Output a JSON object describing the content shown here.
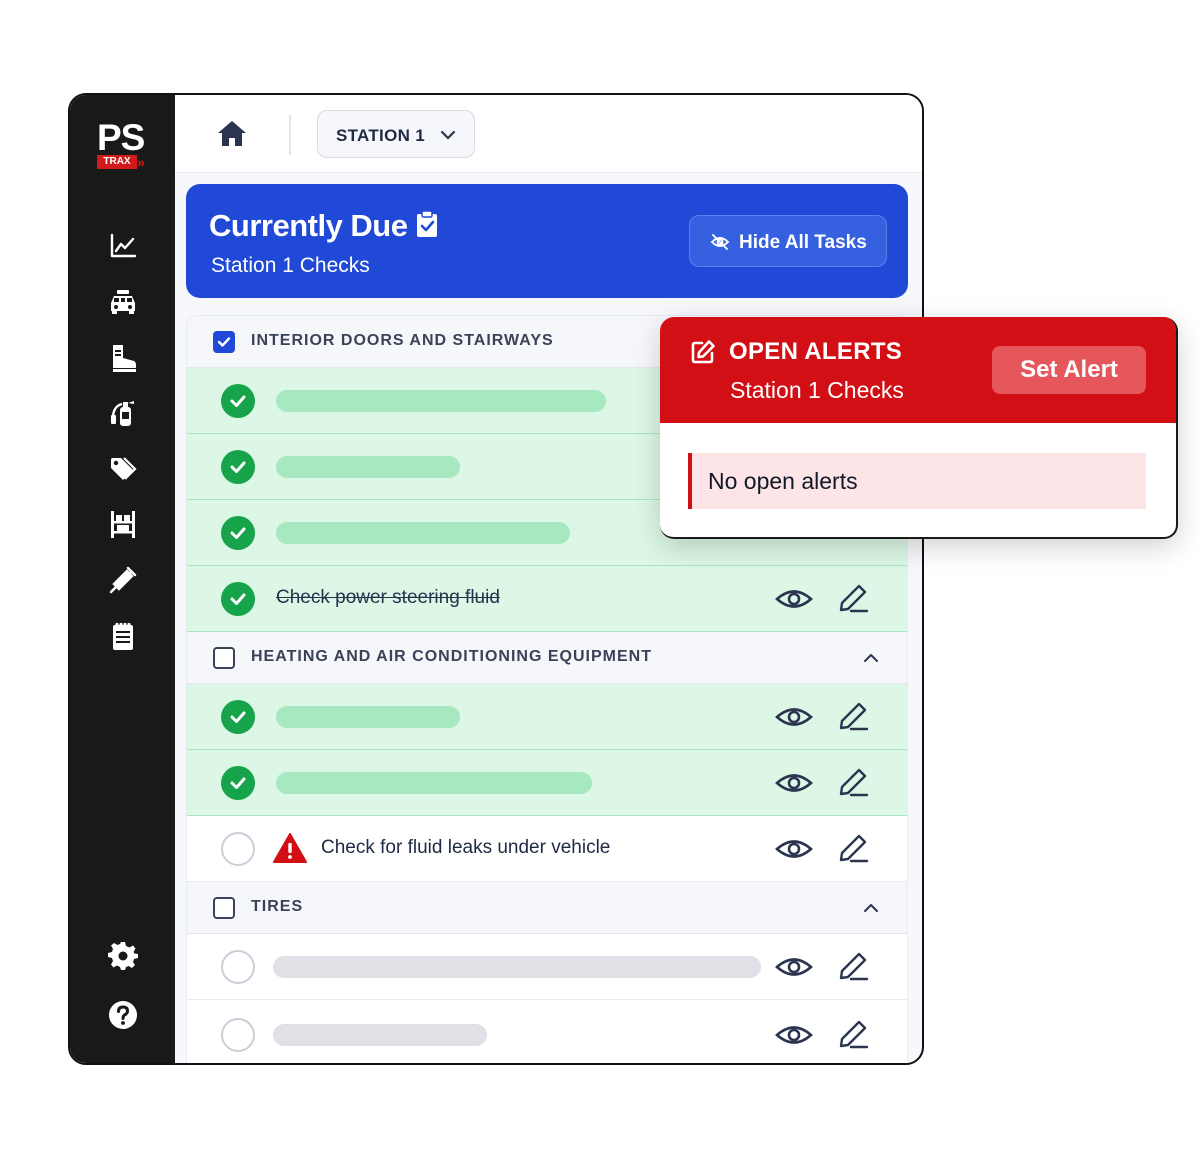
{
  "brand": {
    "logo_text": "PS",
    "logo_sub": "TRAX",
    "logo_chevrons": "»"
  },
  "colors": {
    "sidebar": "#191919",
    "primary": "#1f49d6",
    "done_row": "#dcf7e5",
    "done_check": "#16a34a",
    "alert_red": "#d10f14",
    "alert_empty_bg": "#fde4e6"
  },
  "sidebar": {
    "items": [
      {
        "icon": "chart-line-icon"
      },
      {
        "icon": "vehicle-icon"
      },
      {
        "icon": "boot-icon"
      },
      {
        "icon": "extinguisher-icon"
      },
      {
        "icon": "tags-icon"
      },
      {
        "icon": "storage-rack-icon"
      },
      {
        "icon": "syringe-icon"
      },
      {
        "icon": "notepad-icon"
      }
    ],
    "bottom": [
      {
        "icon": "gear-icon"
      },
      {
        "icon": "help-icon"
      }
    ]
  },
  "topbar": {
    "station_select": "STATION 1"
  },
  "due_card": {
    "title": "Currently Due",
    "subtitle": "Station 1 Checks",
    "hide_button": "Hide All Tasks"
  },
  "sections": [
    {
      "title": "INTERIOR DOORS AND STAIRWAYS",
      "checked": true,
      "tasks": [
        {
          "status": "done",
          "text": ""
        },
        {
          "status": "done",
          "text": ""
        },
        {
          "status": "done",
          "text": ""
        },
        {
          "status": "done",
          "text": "Check power steering fluid"
        }
      ]
    },
    {
      "title": "HEATING AND AIR CONDITIONING EQUIPMENT",
      "checked": false,
      "tasks": [
        {
          "status": "done",
          "text": ""
        },
        {
          "status": "done",
          "text": ""
        },
        {
          "status": "open",
          "warning": true,
          "text": "Check for fluid leaks under vehicle"
        }
      ]
    },
    {
      "title": "TIRES",
      "checked": false,
      "tasks": [
        {
          "status": "open",
          "text": ""
        },
        {
          "status": "open",
          "text": ""
        }
      ]
    }
  ],
  "alerts": {
    "title": "OPEN ALERTS",
    "subtitle": "Station 1 Checks",
    "set_alert_button": "Set Alert",
    "empty_message": "No open alerts"
  }
}
